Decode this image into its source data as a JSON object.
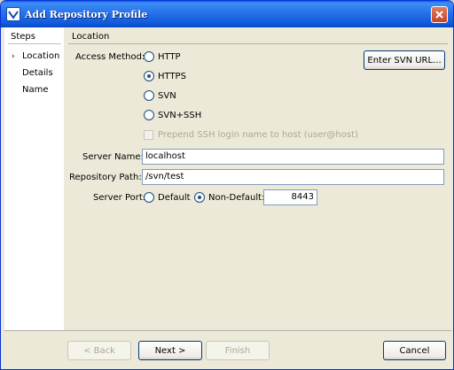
{
  "window": {
    "title": "Add Repository Profile"
  },
  "steps": {
    "title": "Steps",
    "items": [
      {
        "label": "Location",
        "current": true
      },
      {
        "label": "Details",
        "current": false
      },
      {
        "label": "Name",
        "current": false
      }
    ]
  },
  "location": {
    "section_title": "Location",
    "access_method_label": "Access Method:",
    "methods": [
      {
        "label": "HTTP",
        "selected": false
      },
      {
        "label": "HTTPS",
        "selected": true
      },
      {
        "label": "SVN",
        "selected": false
      },
      {
        "label": "SVN+SSH",
        "selected": false
      }
    ],
    "enter_url_button": "Enter SVN URL...",
    "prepend_ssh_label": "Prepend SSH login name to host (user@host)",
    "server_name_label": "Server Name:",
    "server_name_value": "localhost",
    "repository_path_label": "Repository Path:",
    "repository_path_value": "/svn/test",
    "server_port_label": "Server Port:",
    "port_default_label": "Default",
    "port_nondefault_label": "Non-Default:",
    "port_value": "8443"
  },
  "footer": {
    "back": "< Back",
    "next": "Next >",
    "finish": "Finish",
    "cancel": "Cancel"
  }
}
